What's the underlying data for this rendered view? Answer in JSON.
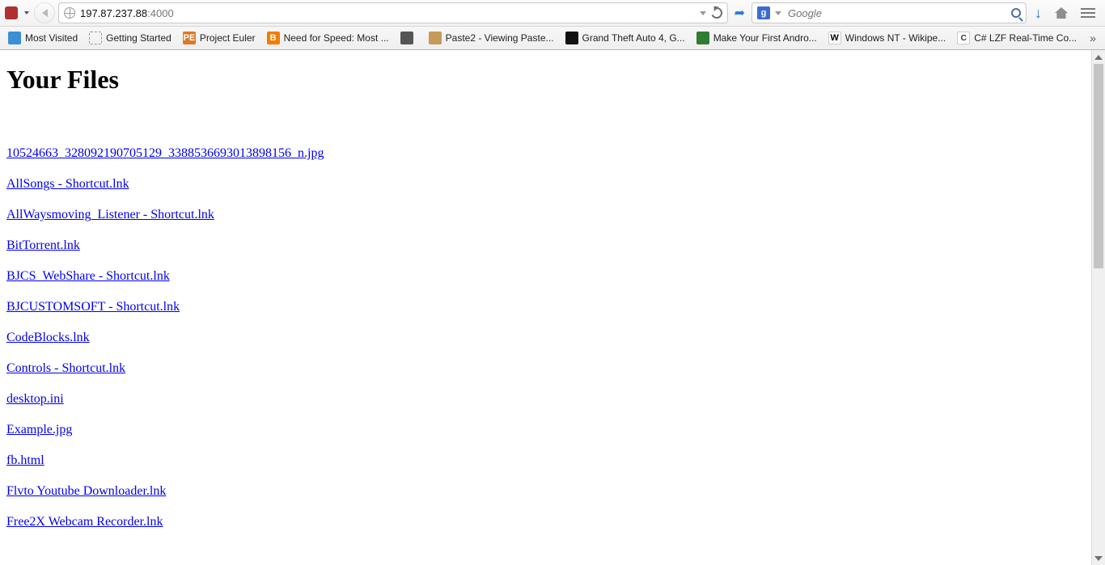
{
  "url": {
    "host": "197.87.237.88",
    "port": ":4000"
  },
  "search": {
    "placeholder": "Google",
    "engine_chip": "g"
  },
  "bookmarks": [
    {
      "label": "Most Visited",
      "fav": "blue"
    },
    {
      "label": "Getting Started",
      "fav": "dashed"
    },
    {
      "label": "Project Euler",
      "fav": "pe",
      "chip": "PE"
    },
    {
      "label": "Need for Speed: Most ...",
      "fav": "blog",
      "chip": "B"
    },
    {
      "label": "",
      "fav": "ns"
    },
    {
      "label": "Paste2 - Viewing Paste...",
      "fav": "clip"
    },
    {
      "label": "Grand Theft Auto 4, G...",
      "fav": "gta"
    },
    {
      "label": "Make Your First Andro...",
      "fav": "andr"
    },
    {
      "label": "Windows NT - Wikipe...",
      "fav": "w",
      "chip": "W"
    },
    {
      "label": "C# LZF Real-Time Co...",
      "fav": "cs",
      "chip": "C"
    }
  ],
  "bookmarks_overflow": "»",
  "page": {
    "heading": "Your Files",
    "files": [
      "10524663_328092190705129_3388536693013898156_n.jpg",
      "AllSongs - Shortcut.lnk",
      "AllWaysmoving_Listener - Shortcut.lnk",
      "BitTorrent.lnk",
      "BJCS_WebShare - Shortcut.lnk",
      "BJCUSTOMSOFT - Shortcut.lnk",
      "CodeBlocks.lnk",
      "Controls - Shortcut.lnk",
      "desktop.ini",
      "Example.jpg",
      "fb.html",
      "Flvto Youtube Downloader.lnk",
      "Free2X Webcam Recorder.lnk"
    ]
  }
}
